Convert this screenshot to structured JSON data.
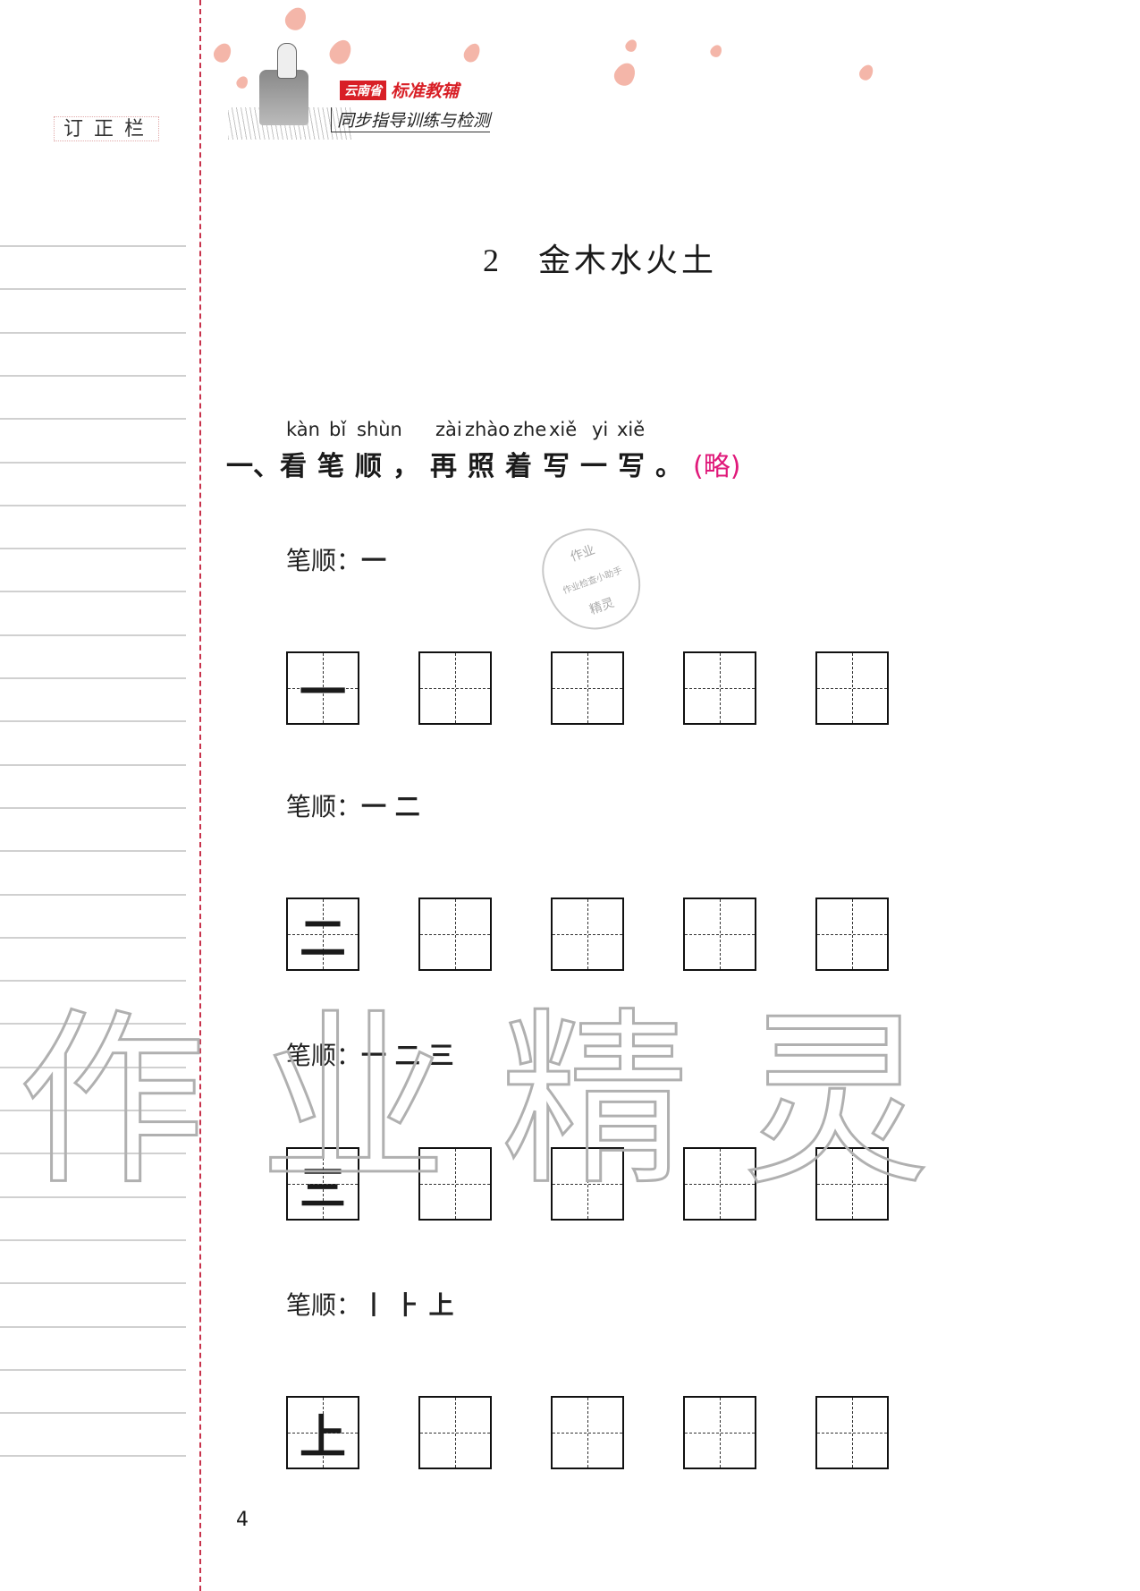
{
  "sidebar": {
    "correction_label": "订正栏",
    "rule_line_count": 29
  },
  "header": {
    "badge": "云南省",
    "brand": "标准教辅",
    "subtitle": "同步指导训练与检测"
  },
  "lesson": {
    "number": "2",
    "title": "金木水火土"
  },
  "question": {
    "pinyin": [
      "kàn",
      "bǐ",
      "shùn",
      "zài",
      "zhào",
      "zhe",
      "xiě",
      "yi",
      "xiě"
    ],
    "number": "一、",
    "text": "看笔顺，再照着写一写。",
    "answer_note": "(略)"
  },
  "stamp": {
    "top": "作业",
    "middle": "作业检查小助手",
    "bottom": "精灵"
  },
  "exercises": [
    {
      "label": "笔顺：",
      "strokes": "一",
      "character": "一",
      "blank_cells": 4
    },
    {
      "label": "笔顺：",
      "strokes": "一 二",
      "character": "二",
      "blank_cells": 4
    },
    {
      "label": "笔顺：",
      "strokes": "一 二 三",
      "character": "三",
      "blank_cells": 4
    },
    {
      "label": "笔顺：",
      "strokes": "丨 ⺊ 上",
      "character": "上",
      "blank_cells": 4
    }
  ],
  "watermark": "作业精灵",
  "page_number": "4",
  "colors": {
    "accent_pink": "#e0197a",
    "brand_red": "#d81f26",
    "binding_line": "#c8334c"
  }
}
